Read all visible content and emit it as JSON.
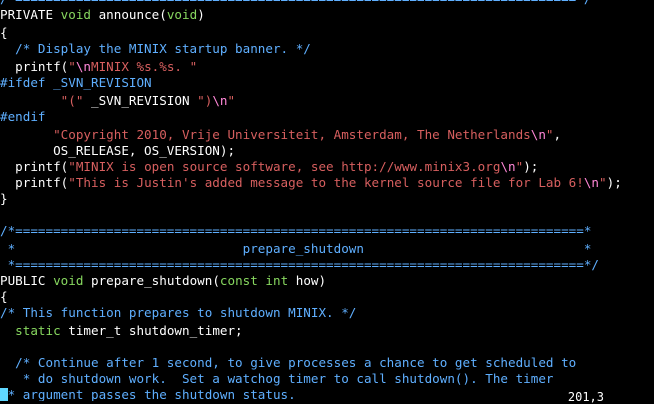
{
  "editor": {
    "lines": [
      {
        "segments": [
          {
            "c": "cm",
            "t": "/*==========================================================================*/"
          }
        ]
      },
      {
        "segments": [
          {
            "c": "",
            "t": "PRIVATE "
          },
          {
            "c": "ty",
            "t": "void"
          },
          {
            "c": "",
            "t": " announce("
          },
          {
            "c": "ty",
            "t": "void"
          },
          {
            "c": "",
            "t": ")"
          }
        ]
      },
      {
        "segments": [
          {
            "c": "",
            "t": "{"
          }
        ]
      },
      {
        "segments": [
          {
            "c": "cm",
            "t": "  /* Display the MINIX startup banner. */"
          }
        ]
      },
      {
        "segments": [
          {
            "c": "",
            "t": "  printf("
          },
          {
            "c": "st",
            "t": "\""
          },
          {
            "c": "esc",
            "t": "\\n"
          },
          {
            "c": "st",
            "t": "MINIX %s.%s. \""
          }
        ]
      },
      {
        "segments": [
          {
            "c": "pp",
            "t": "#ifdef _SVN_REVISION"
          }
        ]
      },
      {
        "segments": [
          {
            "c": "st",
            "t": "        \"(\""
          },
          {
            "c": "",
            "t": " _SVN_REVISION "
          },
          {
            "c": "st",
            "t": "\")"
          },
          {
            "c": "esc",
            "t": "\\n"
          },
          {
            "c": "st",
            "t": "\""
          }
        ]
      },
      {
        "segments": [
          {
            "c": "pp",
            "t": "#endif"
          }
        ]
      },
      {
        "segments": [
          {
            "c": "st",
            "t": "       \"Copyright 2010, Vrije Universiteit, Amsterdam, The Netherlands"
          },
          {
            "c": "esc",
            "t": "\\n"
          },
          {
            "c": "st",
            "t": "\""
          },
          {
            "c": "",
            "t": ","
          }
        ]
      },
      {
        "segments": [
          {
            "c": "",
            "t": "       OS_RELEASE, OS_VERSION);"
          }
        ]
      },
      {
        "segments": [
          {
            "c": "",
            "t": "  printf("
          },
          {
            "c": "st",
            "t": "\"MINIX is open source software, see http://www.minix3.org"
          },
          {
            "c": "esc",
            "t": "\\n"
          },
          {
            "c": "st",
            "t": "\""
          },
          {
            "c": "",
            "t": ");"
          }
        ]
      },
      {
        "segments": [
          {
            "c": "",
            "t": "  printf("
          },
          {
            "c": "st",
            "t": "\"This is Justin's added message to the kernel source file for Lab 6!"
          },
          {
            "c": "esc",
            "t": "\\n"
          },
          {
            "c": "st",
            "t": "\""
          },
          {
            "c": "",
            "t": ");"
          }
        ]
      },
      {
        "segments": [
          {
            "c": "",
            "t": "}"
          }
        ]
      },
      {
        "segments": [
          {
            "c": "",
            "t": ""
          }
        ]
      },
      {
        "segments": [
          {
            "c": "cm",
            "t": "/*===========================================================================*"
          }
        ]
      },
      {
        "segments": [
          {
            "c": "cm",
            "t": " *                              prepare_shutdown                             *"
          }
        ]
      },
      {
        "segments": [
          {
            "c": "cm",
            "t": " *===========================================================================*/"
          }
        ]
      },
      {
        "segments": [
          {
            "c": "",
            "t": "PUBLIC "
          },
          {
            "c": "ty",
            "t": "void"
          },
          {
            "c": "",
            "t": " prepare_shutdown("
          },
          {
            "c": "ty",
            "t": "const"
          },
          {
            "c": "",
            "t": " "
          },
          {
            "c": "ty",
            "t": "int"
          },
          {
            "c": "",
            "t": " how)"
          }
        ]
      },
      {
        "segments": [
          {
            "c": "",
            "t": "{"
          }
        ]
      },
      {
        "segments": [
          {
            "c": "cm",
            "t": "/* This function prepares to shutdown MINIX. */"
          }
        ]
      },
      {
        "segments": [
          {
            "c": "",
            "t": "  "
          },
          {
            "c": "ty",
            "t": "static"
          },
          {
            "c": "",
            "t": " timer_t shutdown_timer;"
          }
        ]
      },
      {
        "segments": [
          {
            "c": "",
            "t": ""
          }
        ]
      },
      {
        "segments": [
          {
            "c": "cm",
            "t": "  /* Continue after 1 second, to give processes a chance to get scheduled to"
          }
        ]
      },
      {
        "segments": [
          {
            "c": "cm",
            "t": "   * do shutdown work.  Set a watchog timer to call shutdown(). The timer"
          }
        ]
      },
      {
        "segments": [
          {
            "c": "cursor",
            "t": " "
          },
          {
            "c": "cm",
            "t": "* argument passes the shutdown status."
          }
        ]
      }
    ]
  },
  "statusbar": {
    "position": "201,3"
  }
}
